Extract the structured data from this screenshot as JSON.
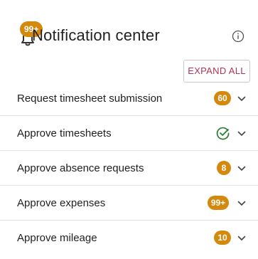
{
  "header": {
    "title": "Notification center",
    "bell_badge": "99+",
    "info_icon": "info-circle-icon",
    "bell_icon": "bell-icon"
  },
  "toolbar": {
    "expand_all_label": "EXPAND ALL"
  },
  "colors": {
    "badge": "#d4880c",
    "accent": "#b03355",
    "success": "#2e7d32"
  },
  "rows": [
    {
      "label": "Request timesheet submission",
      "status": "count",
      "badge": "60"
    },
    {
      "label": "Approve timesheets",
      "status": "done",
      "icon": "check-circle-icon"
    },
    {
      "label": "Approve absence requests",
      "status": "count",
      "badge": "8"
    },
    {
      "label": "Approve expenses",
      "status": "count",
      "badge": "99+"
    },
    {
      "label": "Approve mileage",
      "status": "count",
      "badge": "10"
    }
  ]
}
